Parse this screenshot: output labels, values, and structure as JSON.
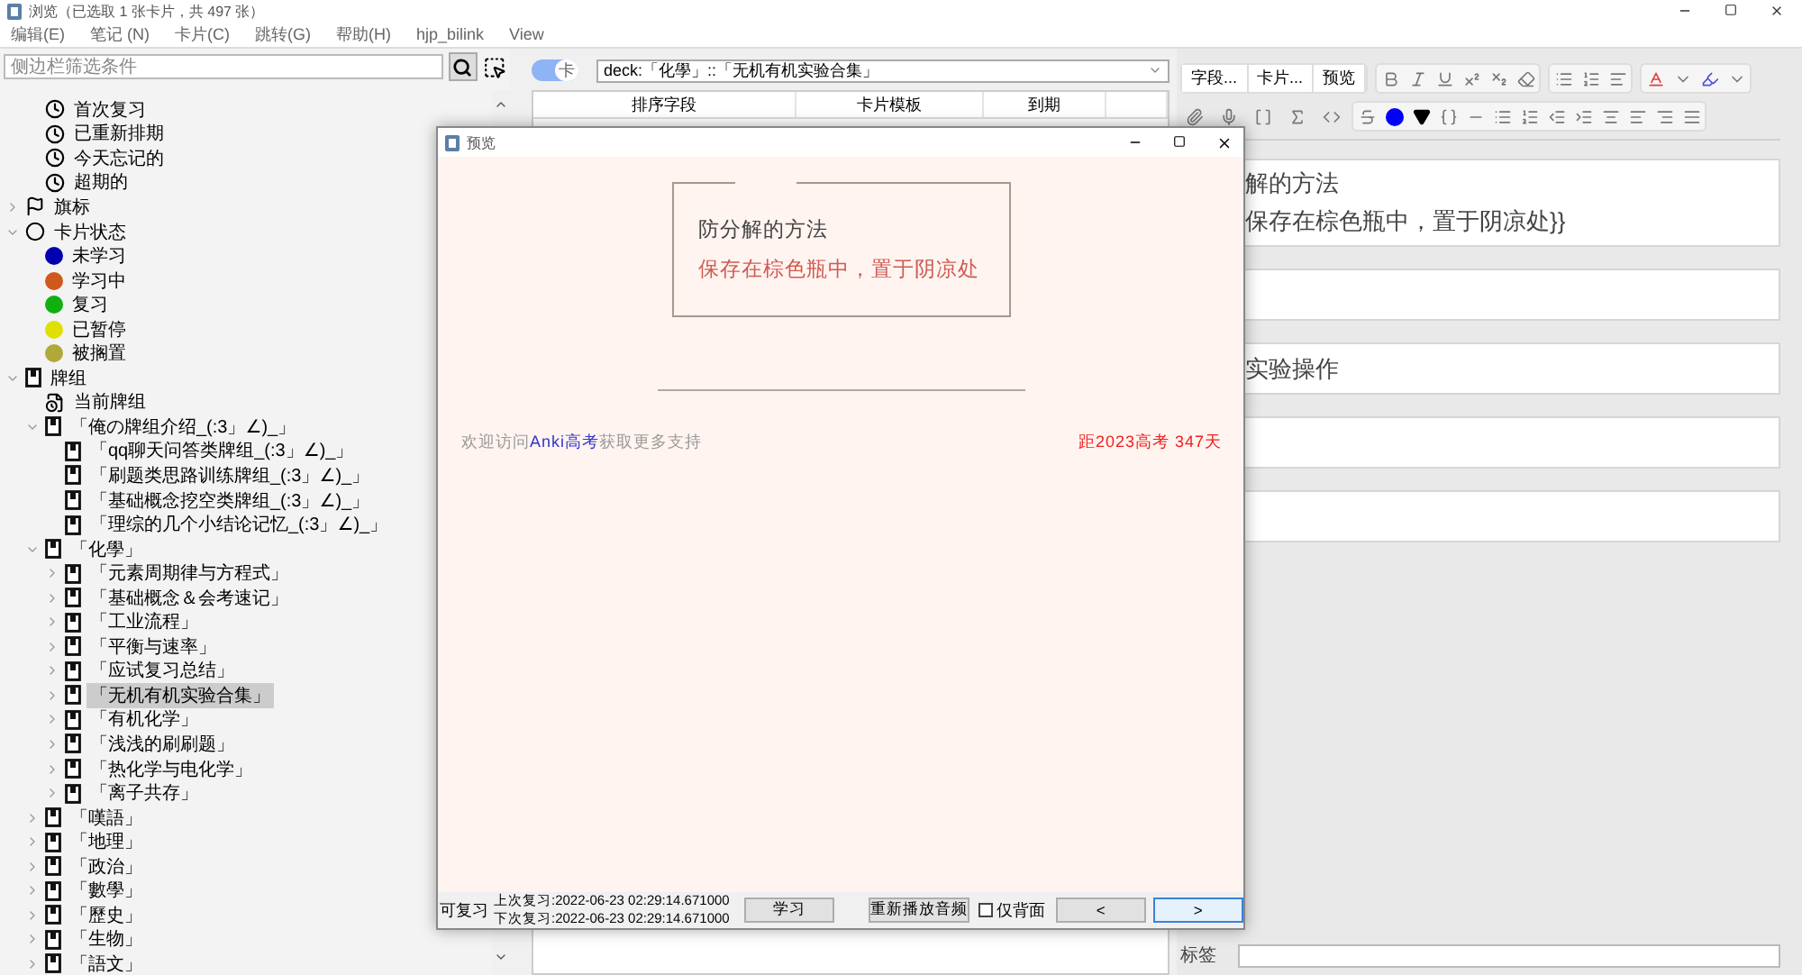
{
  "window": {
    "title": "浏览（已选取 1 张卡片，共 497 张）"
  },
  "menu": [
    "编辑(E)",
    "笔记 (N)",
    "卡片(C)",
    "跳转(G)",
    "帮助(H)",
    "hjp_bilink",
    "View"
  ],
  "sidebar": {
    "search": {
      "placeholder": "侧边栏筛选条件"
    },
    "partial_items": [
      {
        "label": "首次复习",
        "kind": "clock",
        "selected": false
      },
      {
        "label": "已重新排期",
        "kind": "clock",
        "selected": false
      },
      {
        "label": "今天忘记的",
        "kind": "clock",
        "selected": false
      },
      {
        "label": "超期的",
        "kind": "clock",
        "selected": false
      }
    ],
    "tree": [
      {
        "label": "旗标",
        "kind": "flag",
        "selected": false,
        "expanded": false
      },
      {
        "label": "卡片状态",
        "kind": "status",
        "selected": false,
        "expanded": true,
        "children": [
          {
            "label": "未学习",
            "kind": "dot",
            "color": "#0000b0",
            "selected": false
          },
          {
            "label": "学习中",
            "kind": "dot",
            "color": "#d0581c",
            "selected": false
          },
          {
            "label": "复习",
            "kind": "dot",
            "color": "#10b010",
            "selected": false
          },
          {
            "label": "已暂停",
            "kind": "dot",
            "color": "#e0e000",
            "selected": false
          },
          {
            "label": "被搁置",
            "kind": "dot",
            "color": "#b0a838",
            "selected": false
          }
        ]
      },
      {
        "label": "牌组",
        "kind": "deck",
        "selected": false,
        "expanded": true,
        "children": [
          {
            "label": "当前牌组",
            "kind": "current-deck",
            "selected": false
          },
          {
            "label": "「俺の牌组介绍_(:3」∠)_」",
            "kind": "deck",
            "selected": false,
            "expanded": true,
            "children": [
              {
                "label": "「qq聊天问答类牌组_(:3」∠)_」",
                "kind": "deck",
                "selected": false
              },
              {
                "label": "「刷题类思路训练牌组_(:3」∠)_」",
                "kind": "deck",
                "selected": false
              },
              {
                "label": "「基础概念挖空类牌组_(:3」∠)_」",
                "kind": "deck",
                "selected": false
              },
              {
                "label": "「理综的几个小结论记忆_(:3」∠)_」",
                "kind": "deck",
                "selected": false
              }
            ]
          },
          {
            "label": "「化學」",
            "kind": "deck",
            "selected": false,
            "expanded": true,
            "children": [
              {
                "label": "「元素周期律与方程式」",
                "kind": "deck",
                "selected": false,
                "expanded": false
              },
              {
                "label": "「基础概念＆会考速记」",
                "kind": "deck",
                "selected": false,
                "expanded": false
              },
              {
                "label": "「工业流程」",
                "kind": "deck",
                "selected": false,
                "expanded": false
              },
              {
                "label": "「平衡与速率」",
                "kind": "deck",
                "selected": false,
                "expanded": false
              },
              {
                "label": "「应试复习总结」",
                "kind": "deck",
                "selected": false,
                "expanded": false
              },
              {
                "label": "「无机有机实验合集」",
                "kind": "deck",
                "selected": true,
                "expanded": false
              },
              {
                "label": "「有机化学」",
                "kind": "deck",
                "selected": false,
                "expanded": false
              },
              {
                "label": "「浅浅的刷刷题」",
                "kind": "deck",
                "selected": false,
                "expanded": false
              },
              {
                "label": "「热化学与电化学」",
                "kind": "deck",
                "selected": false,
                "expanded": false
              },
              {
                "label": "「离子共存」",
                "kind": "deck",
                "selected": false,
                "expanded": false
              }
            ]
          },
          {
            "label": "「嘆語」",
            "kind": "deck",
            "selected": false,
            "expanded": false
          },
          {
            "label": "「地理」",
            "kind": "deck",
            "selected": false,
            "expanded": false
          },
          {
            "label": "「政治」",
            "kind": "deck",
            "selected": false,
            "expanded": false
          },
          {
            "label": "「數學」",
            "kind": "deck",
            "selected": false,
            "expanded": false
          },
          {
            "label": "「歷史」",
            "kind": "deck",
            "selected": false,
            "expanded": false
          },
          {
            "label": "「生物」",
            "kind": "deck",
            "selected": false,
            "expanded": false
          },
          {
            "label": "「語文」",
            "kind": "deck",
            "selected": false,
            "expanded": false
          }
        ]
      }
    ]
  },
  "browser": {
    "mode_toggle": {
      "label": "卡",
      "on": true
    },
    "search": "deck:「化學」::「无机有机实验合集」",
    "columns": [
      "排序字段",
      "卡片模板",
      "到期"
    ]
  },
  "editor": {
    "buttons": [
      "字段...",
      "卡片...",
      "预览"
    ],
    "fields": [
      {
        "kind": "text",
        "lines": [
          "解的方法",
          "保存在棕色瓶中，置于阴凉处}}"
        ]
      },
      {
        "kind": "blank"
      },
      {
        "kind": "text",
        "lines": [
          "实验操作"
        ]
      },
      {
        "kind": "blank"
      },
      {
        "kind": "blank"
      }
    ],
    "tags_label": "标签"
  },
  "preview": {
    "title": "预览",
    "question": "防分解的方法",
    "answer": "保存在棕色瓶中，置于阴凉处",
    "footer": {
      "before": "欢迎访问",
      "link": "Anki高考",
      "after": "获取更多支持",
      "countdown": "距2023高考 347天"
    },
    "status": "可复习",
    "last_review": "上次复习:2022-06-23 02:29:14.671000",
    "next_review": "下次复习:2022-06-23 02:29:14.671000",
    "buttons": [
      "学习",
      "重新播放音频"
    ],
    "back_only": {
      "label": "仅背面",
      "checked": false
    },
    "nav": [
      {
        "symbol": "<",
        "selected": false
      },
      {
        "symbol": ">",
        "selected": true
      }
    ]
  }
}
